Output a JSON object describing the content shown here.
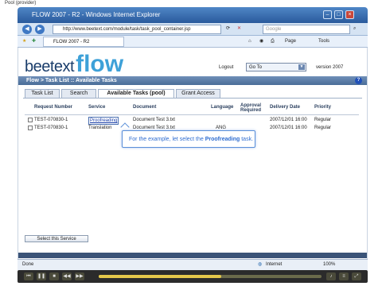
{
  "popup": {
    "title": "Pool (provider)"
  },
  "browser": {
    "window_title": "FLOW 2007 - R2 - Windows Internet Explorer",
    "address": "http://www.beetext.com/module/task/task_pool_container.jsp",
    "search_placeholder": "Google",
    "tab_label": "FLOW 2007 - R2",
    "page_menu": "Page",
    "tools_menu": "Tools",
    "status_left": "Done",
    "status_zone": "Internet",
    "zoom": "100%"
  },
  "app": {
    "logo_beetext": "beetext",
    "logo_flow": "flow",
    "logout": "Logout",
    "goto_value": "Go To",
    "version": "version 2007",
    "breadcrumb": "Flow > Task List :: Available Tasks",
    "help_glyph": "?"
  },
  "tabs": [
    {
      "label": "Task List"
    },
    {
      "label": "Search"
    },
    {
      "label": "Available Tasks (pool)"
    },
    {
      "label": "Grant Access"
    }
  ],
  "table": {
    "headers": [
      "Request Number",
      "Service",
      "Document",
      "Language",
      "Approval Required",
      "Delivery Date",
      "Priority"
    ],
    "rows": [
      {
        "request": "TEST-070830-1",
        "service": "Proofreading",
        "document": "Document Test 3.txt",
        "language": "",
        "approval": "",
        "delivery": "2007/12/01 16:00",
        "priority": "Regular"
      },
      {
        "request": "TEST-070830-1",
        "service": "Translation",
        "document": "Document Test 3.txt",
        "language": "ANG",
        "approval": "",
        "delivery": "2007/12/01 16:00",
        "priority": "Regular"
      }
    ]
  },
  "tooltip": {
    "prefix": "For the example, let select the ",
    "highlight": "Proofreading",
    "suffix": " task."
  },
  "select_button": "Select this Service",
  "player": {
    "progress": 0.55
  }
}
